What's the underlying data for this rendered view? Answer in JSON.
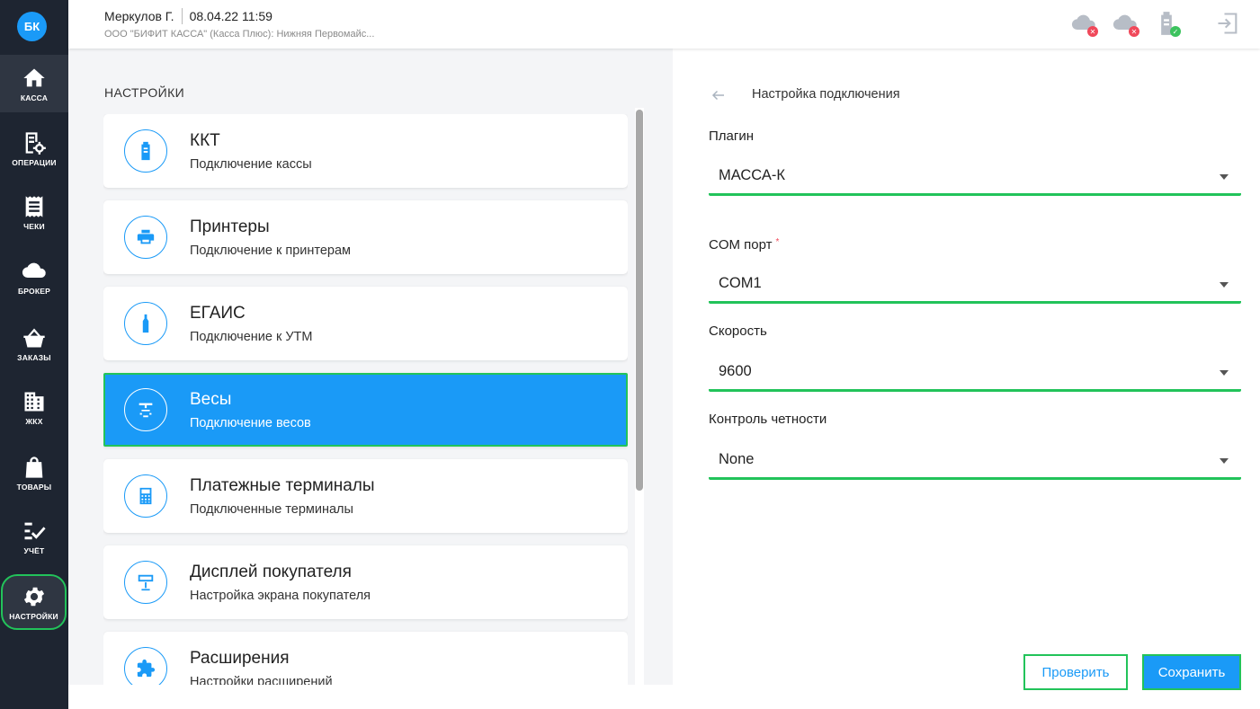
{
  "user": {
    "initials": "БК",
    "name": "Меркулов Г.",
    "datetime": "08.04.22 11:59",
    "org": "ООО \"БИФИТ КАССА\" (Касса Плюс): Нижняя Первомайс..."
  },
  "nav": [
    {
      "label": "КАССА",
      "icon": "home-icon"
    },
    {
      "label": "ОПЕРАЦИИ",
      "icon": "operations-icon"
    },
    {
      "label": "ЧЕКИ",
      "icon": "receipt-icon"
    },
    {
      "label": "БРОКЕР",
      "icon": "cloud-icon"
    },
    {
      "label": "ЗАКАЗЫ",
      "icon": "basket-icon"
    },
    {
      "label": "ЖКХ",
      "icon": "building-icon"
    },
    {
      "label": "ТОВАРЫ",
      "icon": "bag-icon"
    },
    {
      "label": "УЧЁТ",
      "icon": "checklist-icon"
    },
    {
      "label": "НАСТРОЙКИ",
      "icon": "gear-icon"
    }
  ],
  "header_icons": [
    "cloud-error-icon",
    "cloud-error-icon",
    "device-ok-icon",
    "exit-icon"
  ],
  "settings": {
    "title": "НАСТРОЙКИ",
    "cards": [
      {
        "title": "ККТ",
        "subtitle": "Подключение кассы",
        "icon": "kkt-icon"
      },
      {
        "title": "Принтеры",
        "subtitle": "Подключение к принтерам",
        "icon": "printer-icon"
      },
      {
        "title": "ЕГАИС",
        "subtitle": "Подключение к УТМ",
        "icon": "bottle-icon"
      },
      {
        "title": "Весы",
        "subtitle": "Подключение весов",
        "icon": "scales-icon"
      },
      {
        "title": "Платежные терминалы",
        "subtitle": "Подключенные терминалы",
        "icon": "calculator-icon"
      },
      {
        "title": "Дисплей покупателя",
        "subtitle": "Настройка экрана покупателя",
        "icon": "display-icon"
      },
      {
        "title": "Расширения",
        "subtitle": "Настройки расширений",
        "icon": "puzzle-icon"
      }
    ]
  },
  "form": {
    "title": "Настройка подключения",
    "plugin": {
      "label": "Плагин",
      "value": "МАССА-К"
    },
    "com_port": {
      "label": "COM порт",
      "required_mark": "*",
      "value": "COM1"
    },
    "speed": {
      "label": "Скорость",
      "value": "9600"
    },
    "parity": {
      "label": "Контроль четности",
      "value": "None"
    },
    "check_button": "Проверить",
    "save_button": "Сохранить"
  },
  "colors": {
    "accent": "#1a9af7",
    "sidebar": "#1e2531",
    "highlight": "#22c35a",
    "error": "#f0485a"
  }
}
